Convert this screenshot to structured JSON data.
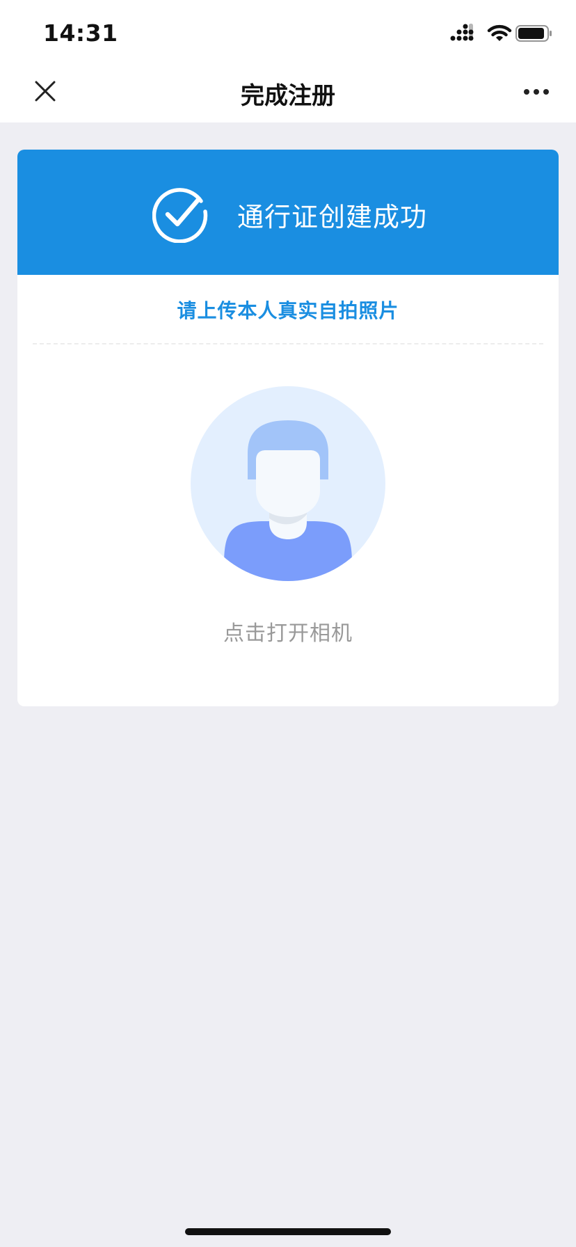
{
  "status_bar": {
    "time": "14:31",
    "icons": [
      "cellular-signal-icon",
      "wifi-icon",
      "battery-icon"
    ]
  },
  "nav": {
    "title": "完成注册",
    "left_icon": "close-icon",
    "right_icon": "more-icon"
  },
  "card": {
    "header_text": "通行证创建成功",
    "header_icon": "check-circle-icon",
    "upload_prompt": "请上传本人真实自拍照片",
    "avatar_icon": "avatar-placeholder-icon",
    "camera_hint": "点击打开相机"
  },
  "colors": {
    "accent": "#1a8ee1",
    "background": "#eeeef3",
    "hint_text": "#999999",
    "avatar_bg": "#e3effe",
    "avatar_hair": "#a2c4f9",
    "avatar_shirt": "#7b9dfb"
  }
}
